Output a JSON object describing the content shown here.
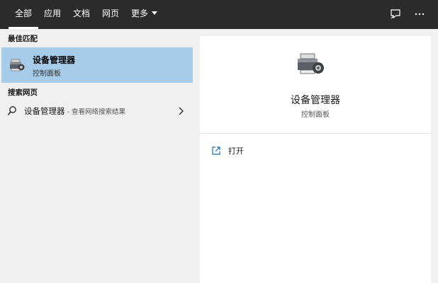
{
  "tabs": [
    {
      "label": "全部",
      "active": true
    },
    {
      "label": "应用"
    },
    {
      "label": "文档"
    },
    {
      "label": "网页"
    },
    {
      "label": "更多"
    }
  ],
  "topbar_icons": [
    "feedback-icon",
    "more-icon"
  ],
  "left": {
    "best_match_heading": "最佳匹配",
    "best_match": {
      "title": "设备管理器",
      "subtitle": "控制面板",
      "icon": "device-manager-icon"
    },
    "web_heading": "搜索网页",
    "web_result": {
      "label": "设备管理器",
      "sub": " - 查看网络搜索结果"
    }
  },
  "detail": {
    "title": "设备管理器",
    "subtitle": "控制面板",
    "actions": [
      {
        "label": "打开",
        "icon": "open-icon"
      }
    ]
  },
  "colors": {
    "topbar": "#2b2b2b",
    "selected": "#a7ccea",
    "panel": "#ffffff",
    "background": "#f0f0f0"
  }
}
